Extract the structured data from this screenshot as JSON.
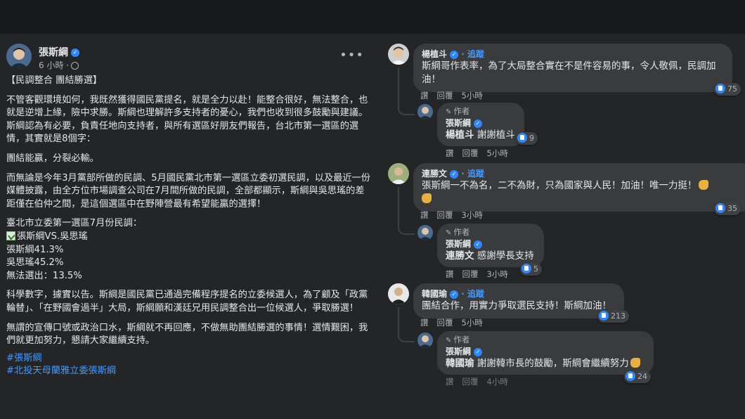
{
  "post": {
    "author": "張斯綱",
    "time": "6 小時 ·",
    "more": "•••",
    "title": "【民調整合  團結勝選】",
    "paragraphs": [
      "不管客觀環境如何，我既然獲得國民黨提名，就是全力以赴！能整合很好，無法整合，也就是逆增上緣，險中求勝。斯綱也理解許多支持者的憂心，我們也收到很多鼓勵與建議。斯綱認為有必要，負責任地向支持者，與所有選區好朋友們報告，台北市第一選區的選情，其實就是8個字：",
      "團結能贏，分裂必輸。",
      "而無論是今年3月黨部所做的民調、5月國民黨北市第一選區立委初選民調，以及最近一份媒體披露，由全方位市場調查公司在7月間所做的民調，全部都顯示，斯綱與吳思瑤的差距僅在伯仲之間，是這個選區中在野陣營最有希望能贏的選擇！"
    ],
    "poll_title": "臺北市立委第一選區7月份民調：",
    "poll_matchup": "張斯綱VS.吳思瑤",
    "poll_a": "張斯綱41.3%",
    "poll_b": "吳思瑤45.2%",
    "poll_c": "無法選出：13.5%",
    "paragraph_science": "科學數字，據實以告。斯綱是國民黨已通過完備程序提名的立委候選人，為了顧及「政黨輪替」、「在野國會過半」大局，斯綱願和漢廷兄用民調整合出一位候選人，爭取勝選！",
    "paragraph_end": "無謂的宣傳口號或政治口水，斯綱就不再回應，不做無助團結勝選的事情！選情艱困，我們就更加努力，懇請大家繼續支持。",
    "hashtags": [
      "#張斯綱",
      "#北投天母蘭雅立委張斯綱"
    ]
  },
  "comments": [
    {
      "name": "楊植斗",
      "follow": "· 追蹤",
      "text": "斯綱哥作表率，為了大局整合實在不是件容易的事，令人敬佩，民調加油！",
      "like": "讚",
      "reply": "回覆",
      "time": "5小時",
      "reactions": "75",
      "reply_author": {
        "tag": "作者",
        "name": "張斯綱",
        "mention": "楊植斗",
        "text": "謝謝植斗",
        "like": "讚",
        "reply": "回覆",
        "time": "5小時",
        "reactions": "9"
      }
    },
    {
      "name": "連勝文",
      "follow": "· 追蹤",
      "text": "張斯綱一不為名，二不為財，只為國家與人民！加油！唯一力挺！",
      "like": "讚",
      "reply": "回覆",
      "time": "3小時",
      "reactions": "35",
      "reply_author": {
        "tag": "作者",
        "name": "張斯綱",
        "mention": "連勝文",
        "text": "感謝學長支持",
        "like": "讚",
        "reply": "回覆",
        "time": "3小時",
        "reactions": "5"
      }
    },
    {
      "name": "韓國瑜",
      "follow": "· 追蹤",
      "text": "團結合作，用實力爭取選民支持！斯綱加油！",
      "like": "讚",
      "reply": "回覆",
      "time": "5小時",
      "reactions": "213",
      "reply_author": {
        "tag": "作者",
        "name": "張斯綱",
        "mention": "韓國瑜",
        "text": "謝謝韓市長的鼓勵，斯綱會繼續努力",
        "like": "讚",
        "reply": "回覆",
        "time": "4小時",
        "reactions": "24"
      }
    }
  ],
  "colors": {
    "background": "#18191a",
    "panel": "#242526",
    "bubble": "#3a3b3c",
    "link": "#4599ff",
    "verified": "#2d88ff"
  },
  "icons": [
    "verified-badge-icon",
    "globe-icon",
    "more-icon",
    "like-icon",
    "muscle-emoji-icon",
    "check-emoji-icon",
    "pencil-icon"
  ]
}
